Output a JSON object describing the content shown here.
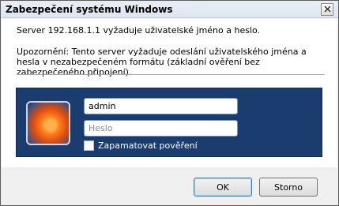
{
  "window": {
    "title": "Zabezpečení systému Windows"
  },
  "message": {
    "line1": "Server 192.168.1.1 vyžaduje uživatelské jméno a heslo.",
    "warning": "Upozornění: Tento server vyžaduje odeslání uživatelského jména a hesla v nezabezpečeném formátu (základní ověření bez zabezpečeného připojení)."
  },
  "credentials": {
    "username_value": "admin",
    "password_placeholder": "Heslo",
    "remember_label": "Zapamatovat pověření",
    "remember_checked": false
  },
  "buttons": {
    "ok": "OK",
    "cancel": "Storno"
  },
  "icons": {
    "close": "close-icon",
    "avatar": "user-avatar"
  },
  "colors": {
    "panel": "#1a3c6e",
    "titlebar": "#dfe6ef"
  }
}
